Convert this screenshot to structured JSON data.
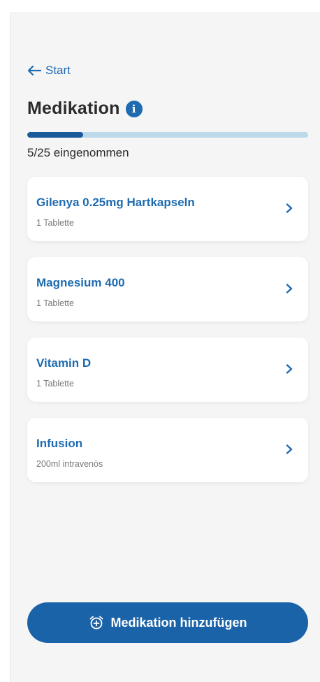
{
  "nav": {
    "back_label": "Start",
    "back_icon": "arrow-left-icon"
  },
  "header": {
    "title": "Medikation",
    "info_icon": "info-icon",
    "info_glyph": "i"
  },
  "progress": {
    "taken": 5,
    "total": 25,
    "fraction": 0.2,
    "label": "5/25 eingenommen"
  },
  "medications": [
    {
      "name": "Gilenya 0.25mg Hartkapseln",
      "dose": "1 Tablette"
    },
    {
      "name": "Magnesium 400",
      "dose": "1 Tablette"
    },
    {
      "name": "Vitamin D",
      "dose": "1 Tablette"
    },
    {
      "name": "Infusion",
      "dose": "200ml intravenös"
    }
  ],
  "actions": {
    "add_label": "Medikation hinzufügen",
    "add_icon": "alarm-add-icon"
  },
  "colors": {
    "accent": "#1e6bb0",
    "button": "#1b63a8",
    "progress_track": "#bcd9ea",
    "progress_fill": "#1b5a9a",
    "background": "#f5f5f5"
  }
}
